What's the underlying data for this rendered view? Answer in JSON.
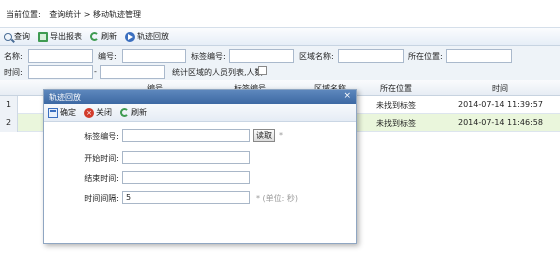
{
  "breadcrumb": {
    "prefix": "当前位置:",
    "path": "查询统计 > 移动轨迹管理"
  },
  "toolbar": {
    "query": "查询",
    "export": "导出报表",
    "refresh": "刷新",
    "playback": "轨迹回放"
  },
  "filter": {
    "name": "名称:",
    "code": "编号:",
    "tag_code": "标签编号:",
    "area_name": "区域名称:",
    "position": "所在位置:",
    "time": "时间:",
    "dash": "-",
    "stat_label": "统计区域的人员列表,人数"
  },
  "grid": {
    "columns": [
      "编号",
      "标签编号",
      "区域名称",
      "所在位置",
      "时间"
    ],
    "rows": [
      {
        "num": "1",
        "position": "未找到标签",
        "time": "2014-07-14 11:39:57"
      },
      {
        "num": "2",
        "position": "未找到标签",
        "time": "2014-07-14 11:46:58"
      }
    ]
  },
  "modal": {
    "title": "轨迹回放",
    "close_x": "×",
    "ok": "确定",
    "close": "关闭",
    "refresh": "刷新",
    "tag_label": "标签编号:",
    "read": "读取",
    "required_mark": "*",
    "start_label": "开始时间:",
    "end_label": "结束时间:",
    "interval_label": "时间间隔:",
    "interval_value": "5",
    "interval_hint": "* (单位: 秒)"
  },
  "colors": {
    "title_bar": "#4a76b0",
    "row_highlight": "#eaf6dc"
  }
}
